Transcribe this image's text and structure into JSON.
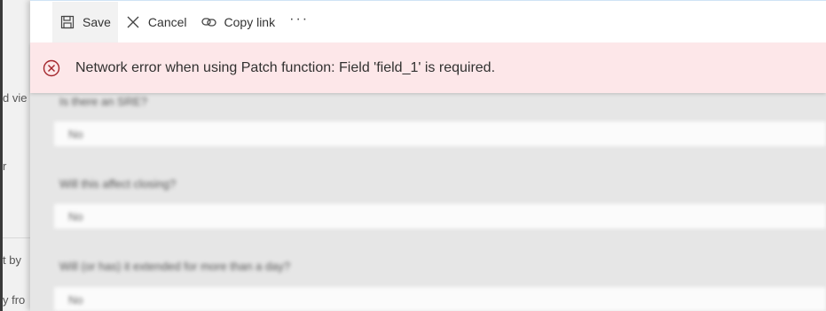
{
  "toolbar": {
    "save_label": "Save",
    "cancel_label": "Cancel",
    "copy_link_label": "Copy link",
    "more_label": "···",
    "icons": {
      "save": "save-icon",
      "cancel": "close-icon",
      "copy_link": "link-icon",
      "more": "more-icon"
    }
  },
  "banner": {
    "message": "Network error when using Patch function: Field 'field_1' is required.",
    "icon": "error-circle-icon",
    "background": "#fde7e9",
    "icon_color": "#a4262c"
  },
  "left_list": {
    "fragments": [
      "d vie",
      "r",
      "t by",
      "y fro"
    ]
  },
  "form": {
    "questions": [
      {
        "label": "Is there an SRE?",
        "value": "No"
      },
      {
        "label": "Will this affect closing?",
        "value": "No"
      },
      {
        "label": "Will (or has) it extended for more than a day?",
        "value": "No"
      }
    ]
  }
}
